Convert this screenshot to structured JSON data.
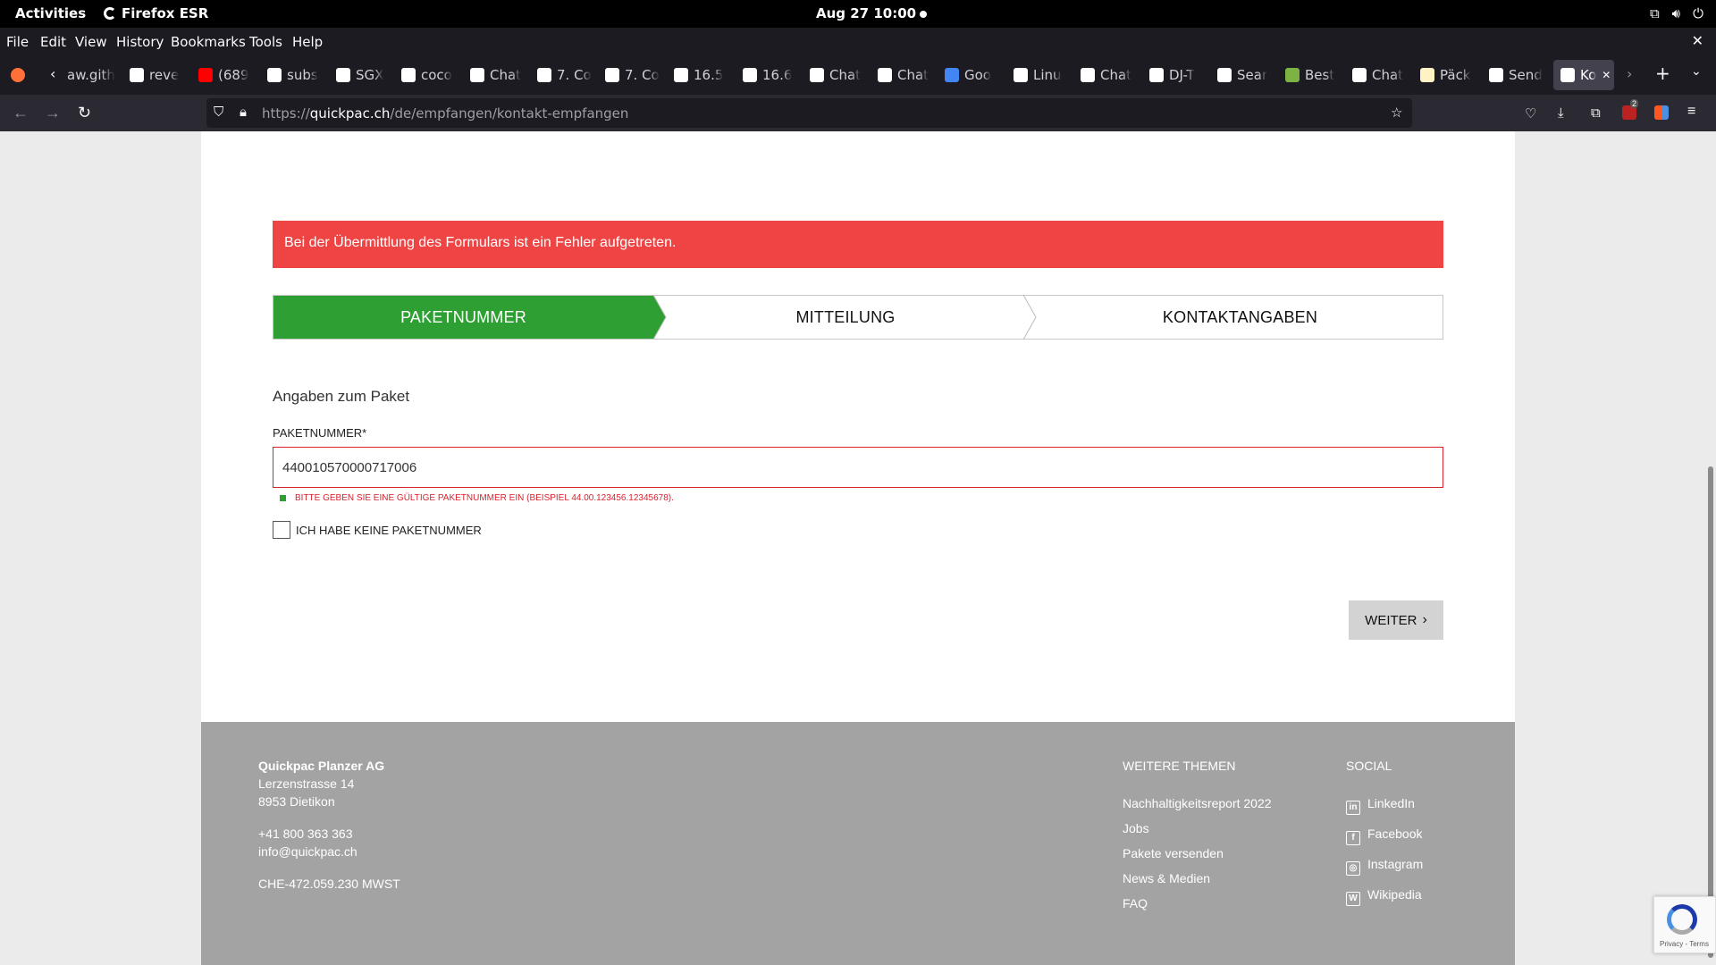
{
  "system_bar": {
    "activities": "Activities",
    "app_name": "Firefox ESR",
    "clock": "Aug 27  10:00"
  },
  "menu": [
    "File",
    "Edit",
    "View",
    "History",
    "Bookmarks",
    "Tools",
    "Help"
  ],
  "tabs": [
    {
      "label": "aw.gith",
      "color": "#1c1b22",
      "icon": "github-icon"
    },
    {
      "label": "reve",
      "color": "#ffffff",
      "icon": "google-icon"
    },
    {
      "label": "(689",
      "color": "#ff0000",
      "icon": "youtube-icon"
    },
    {
      "label": "subs",
      "color": "#ffffff",
      "icon": "google-icon"
    },
    {
      "label": "SGX",
      "color": "#ffffff",
      "icon": "google-icon"
    },
    {
      "label": "coco",
      "color": "#ffffff",
      "icon": "google-icon"
    },
    {
      "label": "Chat",
      "color": "#ffffff",
      "icon": "chatgpt-icon"
    },
    {
      "label": "7. Co",
      "color": "#ffffff",
      "icon": "doc-icon"
    },
    {
      "label": "7. Co",
      "color": "#ffffff",
      "icon": "doc-icon"
    },
    {
      "label": "16.5",
      "color": "#ffffff",
      "icon": "doc-icon"
    },
    {
      "label": "16.6",
      "color": "#ffffff",
      "icon": "doc-icon"
    },
    {
      "label": "Chat",
      "color": "#ffffff",
      "icon": "chatgpt-icon"
    },
    {
      "label": "Chat",
      "color": "#ffffff",
      "icon": "chatgpt-icon"
    },
    {
      "label": "Goo",
      "color": "#4285f4",
      "icon": "translate-icon"
    },
    {
      "label": "Linu",
      "color": "#ffffff",
      "icon": "linux-icon"
    },
    {
      "label": "Chat",
      "color": "#ffffff",
      "icon": "chatgpt-icon"
    },
    {
      "label": "DJ-T",
      "color": "#ffffff",
      "icon": "doc-icon"
    },
    {
      "label": "Sear",
      "color": "#ffffff",
      "icon": "doc-icon"
    },
    {
      "label": "Best",
      "color": "#7cb342",
      "icon": "link-icon"
    },
    {
      "label": "Chat",
      "color": "#ffffff",
      "icon": "chatgpt-icon"
    },
    {
      "label": "Päck",
      "color": "#fff3c4",
      "icon": "doc-icon"
    },
    {
      "label": "Send",
      "color": "#ffffff",
      "icon": "quickpac-icon"
    },
    {
      "label": "Ko",
      "color": "#ffffff",
      "icon": "quickpac-icon",
      "active": true
    }
  ],
  "url": {
    "prefix": "https://",
    "host": "quickpac.ch",
    "path": "/de/empfangen/kontakt-empfangen"
  },
  "error_banner": "Bei der Übermittlung des Formulars ist ein Fehler aufgetreten.",
  "steps": [
    "PAKETNUMMER",
    "MITTEILUNG",
    "KONTAKTANGABEN"
  ],
  "form": {
    "section_title": "Angaben zum Paket",
    "label": "PAKETNUMMER*",
    "value": "440010570000717006",
    "error": "BITTE GEBEN SIE EINE GÜLTIGE PAKETNUMMER EIN (BEISPIEL 44.00.123456.12345678).",
    "checkbox_label": "ICH HABE KEINE PAKETNUMMER",
    "submit": "WEITER"
  },
  "footer": {
    "company": "Quickpac Planzer AG",
    "street": "Lerzenstrasse 14",
    "city": "8953 Dietikon",
    "phone": "+41 800 363 363",
    "email": "info@quickpac.ch",
    "vat": "CHE-472.059.230 MWST",
    "topics_heading": "WEITERE THEMEN",
    "topics": [
      "Nachhaltigkeitsreport 2022",
      "Jobs",
      "Pakete versenden",
      "News & Medien",
      "FAQ"
    ],
    "social_heading": "SOCIAL",
    "social": [
      "LinkedIn",
      "Facebook",
      "Instagram",
      "Wikipedia"
    ]
  },
  "notification_count": "2",
  "recaptcha_text": "Privacy - Terms",
  "colors": {
    "error": "#ef4444",
    "step_active": "#2ea033",
    "footer": "#a3a3a3"
  }
}
